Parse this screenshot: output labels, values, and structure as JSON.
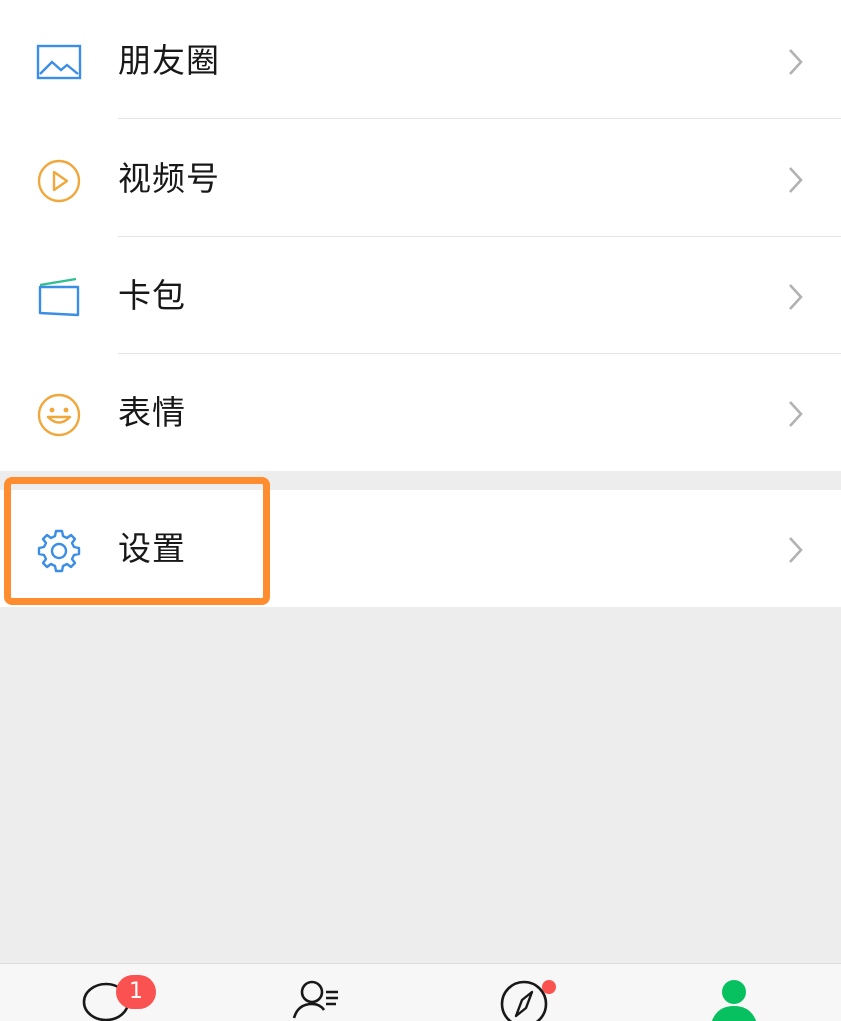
{
  "menu": {
    "items": [
      {
        "label": "朋友圈",
        "icon": "moments-image-icon"
      },
      {
        "label": "视频号",
        "icon": "channels-play-icon"
      },
      {
        "label": "卡包",
        "icon": "card-wallet-icon"
      },
      {
        "label": "表情",
        "icon": "smiley-face-icon"
      }
    ],
    "settings": {
      "label": "设置",
      "icon": "gear-icon"
    }
  },
  "tabbar": {
    "chats_badge": "1",
    "tabs": [
      {
        "icon": "chat-bubble-icon"
      },
      {
        "icon": "contacts-icon"
      },
      {
        "icon": "discover-compass-icon"
      },
      {
        "icon": "me-person-icon",
        "active": true
      }
    ]
  },
  "colors": {
    "highlight": "#ff8c2f",
    "active_tab": "#07c160",
    "badge": "#fa5151",
    "icon_blue": "#3a8ee6",
    "icon_orange": "#f0a83c"
  }
}
